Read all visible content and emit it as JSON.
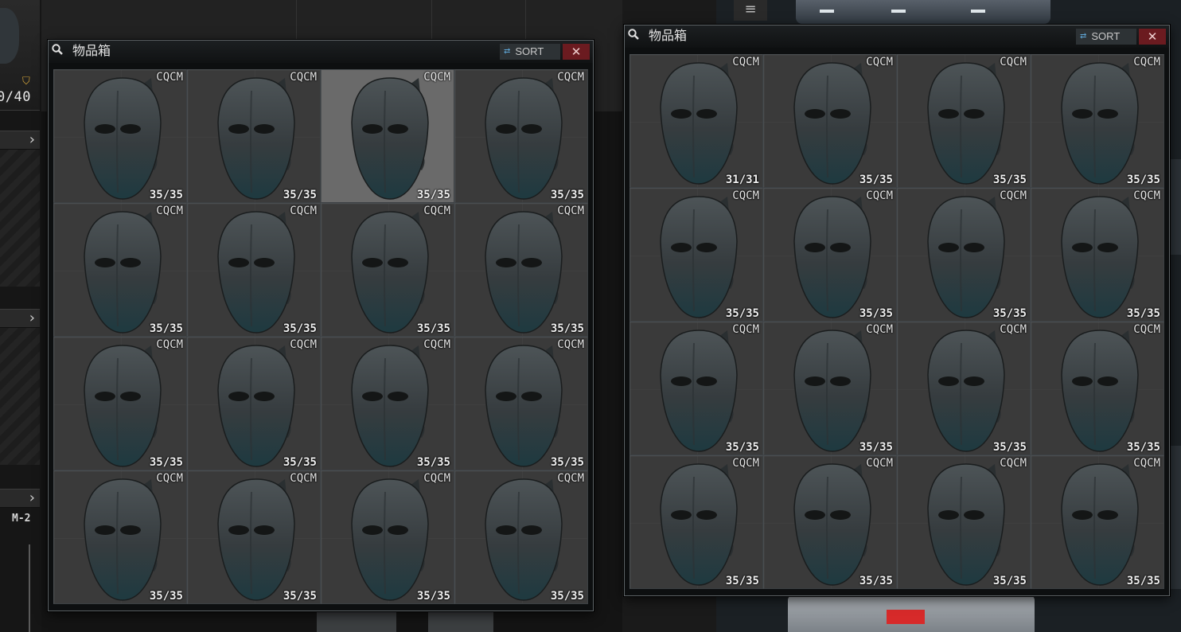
{
  "background": {
    "durability": "0/40",
    "slot_label": "M-2"
  },
  "windows": [
    {
      "title": "物品箱",
      "sort_label": "SORT",
      "close_label": "✕",
      "items": [
        {
          "brand": "CQCM",
          "count": "35/35"
        },
        {
          "brand": "CQCM",
          "count": "35/35"
        },
        {
          "brand": "CQCM",
          "count": "35/35",
          "highlighted": true
        },
        {
          "brand": "CQCM",
          "count": "35/35"
        },
        {
          "brand": "CQCM",
          "count": "35/35"
        },
        {
          "brand": "CQCM",
          "count": "35/35"
        },
        {
          "brand": "CQCM",
          "count": "35/35"
        },
        {
          "brand": "CQCM",
          "count": "35/35"
        },
        {
          "brand": "CQCM",
          "count": "35/35"
        },
        {
          "brand": "CQCM",
          "count": "35/35"
        },
        {
          "brand": "CQCM",
          "count": "35/35"
        },
        {
          "brand": "CQCM",
          "count": "35/35"
        },
        {
          "brand": "CQCM",
          "count": "35/35"
        },
        {
          "brand": "CQCM",
          "count": "35/35"
        },
        {
          "brand": "CQCM",
          "count": "35/35"
        },
        {
          "brand": "CQCM",
          "count": "35/35"
        }
      ]
    },
    {
      "title": "物品箱",
      "sort_label": "SORT",
      "close_label": "✕",
      "items": [
        {
          "brand": "CQCM",
          "count": "31/31"
        },
        {
          "brand": "CQCM",
          "count": "35/35"
        },
        {
          "brand": "CQCM",
          "count": "35/35"
        },
        {
          "brand": "CQCM",
          "count": "35/35"
        },
        {
          "brand": "CQCM",
          "count": "35/35"
        },
        {
          "brand": "CQCM",
          "count": "35/35"
        },
        {
          "brand": "CQCM",
          "count": "35/35"
        },
        {
          "brand": "CQCM",
          "count": "35/35"
        },
        {
          "brand": "CQCM",
          "count": "35/35"
        },
        {
          "brand": "CQCM",
          "count": "35/35"
        },
        {
          "brand": "CQCM",
          "count": "35/35"
        },
        {
          "brand": "CQCM",
          "count": "35/35"
        },
        {
          "brand": "CQCM",
          "count": "35/35"
        },
        {
          "brand": "CQCM",
          "count": "35/35"
        },
        {
          "brand": "CQCM",
          "count": "35/35"
        },
        {
          "brand": "CQCM",
          "count": "35/35"
        }
      ]
    }
  ],
  "icons": {
    "search": "magnifier-icon",
    "sort": "sort-arrows-icon",
    "item": "ballistic-face-mask-icon"
  },
  "colors": {
    "close_button": "#6b1b20",
    "sort_icon": "#5fa6d6",
    "durability_shield": "#d4a43a"
  }
}
